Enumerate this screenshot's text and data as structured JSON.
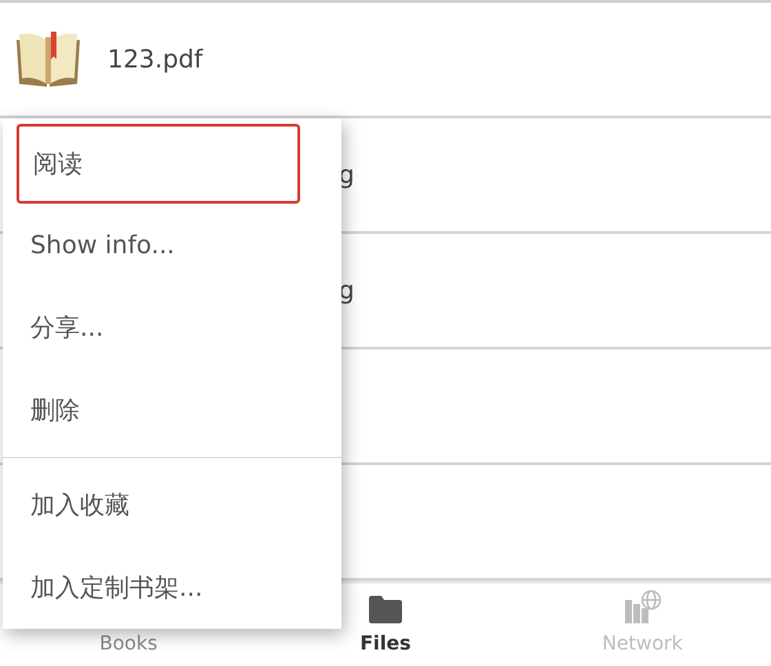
{
  "file_list": [
    {
      "kind": "book",
      "name": "123.pdf"
    },
    {
      "kind": "covered",
      "name": "g"
    },
    {
      "kind": "covered",
      "name": "g"
    },
    {
      "kind": "empty"
    },
    {
      "kind": "empty"
    }
  ],
  "context_menu": {
    "groups": [
      [
        {
          "label": "阅读",
          "highlighted": true
        },
        {
          "label": "Show info...",
          "highlighted": false
        },
        {
          "label": "分享...",
          "highlighted": false
        },
        {
          "label": "删除",
          "highlighted": false
        }
      ],
      [
        {
          "label": "加入收藏",
          "highlighted": false
        },
        {
          "label": "加入定制书架...",
          "highlighted": false
        }
      ]
    ]
  },
  "bottom_nav": [
    {
      "kind": "books",
      "label": "Books",
      "selected": false,
      "disabled": false
    },
    {
      "kind": "files",
      "label": "Files",
      "selected": true,
      "disabled": false
    },
    {
      "kind": "network",
      "label": "Network",
      "selected": false,
      "disabled": true
    }
  ]
}
